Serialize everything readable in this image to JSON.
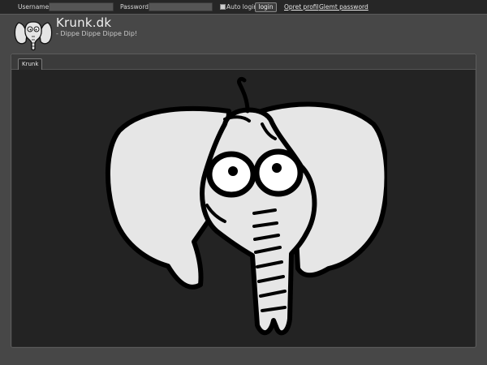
{
  "login_bar": {
    "username_label": "Username:",
    "username_value": "",
    "password_label": "Password:",
    "password_value": "",
    "auto_login_label": "Auto login",
    "auto_login_checked": false,
    "login_button": "login",
    "create_profile_link": "Opret profil",
    "forgot_password_link": "Glemt password"
  },
  "header": {
    "site_title": "Krunk.dk",
    "tagline": "- Dippe Dippe Dippe Dip!",
    "logo_icon": "elephant-logo-icon"
  },
  "main": {
    "tabs": [
      {
        "label": "Krunk"
      }
    ],
    "image_icon": "elephant-head-illustration"
  },
  "colors": {
    "page_bg": "#474747",
    "topbar_bg": "#262626",
    "content_bg": "#232323",
    "elephant_fill": "#e6e6e6",
    "outline": "#000000"
  }
}
